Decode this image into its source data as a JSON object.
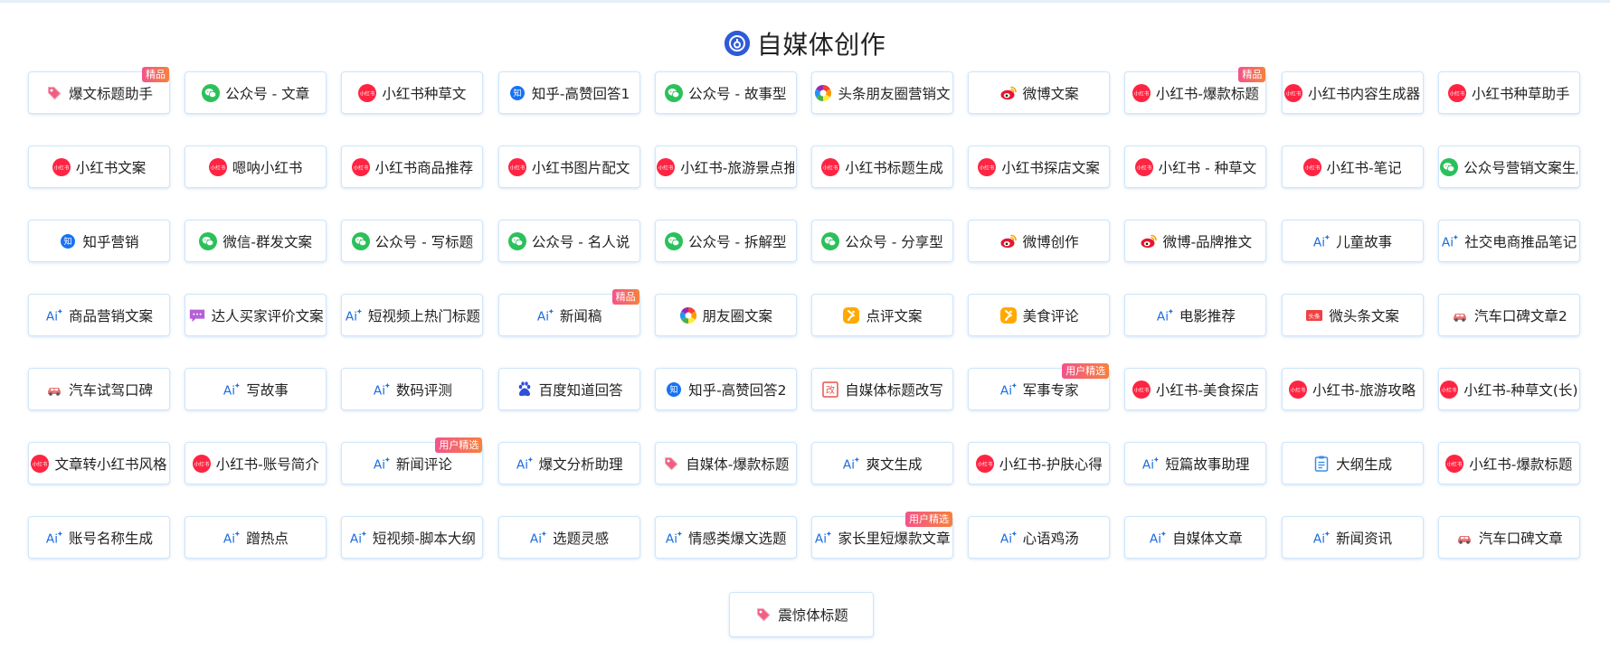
{
  "page": {
    "title": "自媒体创作"
  },
  "items": [
    {
      "label": "爆文标题助手",
      "icon": "tag-icon",
      "badge": "精品"
    },
    {
      "label": "公众号 - 文章",
      "icon": "wechat-icon"
    },
    {
      "label": "小红书种草文",
      "icon": "xiaohongshu-icon"
    },
    {
      "label": "知乎-高赞回答1",
      "icon": "zhihu-icon"
    },
    {
      "label": "公众号 - 故事型",
      "icon": "wechat-icon"
    },
    {
      "label": "头条朋友圈营销文",
      "icon": "aperture-icon"
    },
    {
      "label": "微博文案",
      "icon": "weibo-icon"
    },
    {
      "label": "小红书-爆款标题",
      "icon": "xiaohongshu-icon",
      "badge": "精品"
    },
    {
      "label": "小红书内容生成器",
      "icon": "xiaohongshu-icon"
    },
    {
      "label": "小红书种草助手",
      "icon": "xiaohongshu-icon"
    },
    {
      "label": "小红书文案",
      "icon": "xiaohongshu-icon"
    },
    {
      "label": "嗯呐小红书",
      "icon": "xiaohongshu-icon"
    },
    {
      "label": "小红书商品推荐",
      "icon": "xiaohongshu-icon"
    },
    {
      "label": "小红书图片配文",
      "icon": "xiaohongshu-icon"
    },
    {
      "label": "小红书-旅游景点推荐",
      "icon": "xiaohongshu-icon"
    },
    {
      "label": "小红书标题生成",
      "icon": "xiaohongshu-icon"
    },
    {
      "label": "小红书探店文案",
      "icon": "xiaohongshu-icon"
    },
    {
      "label": "小红书 - 种草文",
      "icon": "xiaohongshu-icon"
    },
    {
      "label": "小红书-笔记",
      "icon": "xiaohongshu-icon"
    },
    {
      "label": "公众号营销文案生成",
      "icon": "wechat-icon"
    },
    {
      "label": "知乎营销",
      "icon": "zhihu-icon"
    },
    {
      "label": "微信-群发文案",
      "icon": "wechat-icon"
    },
    {
      "label": "公众号 - 写标题",
      "icon": "wechat-icon"
    },
    {
      "label": "公众号 - 名人说",
      "icon": "wechat-icon"
    },
    {
      "label": "公众号 - 拆解型",
      "icon": "wechat-icon"
    },
    {
      "label": "公众号 - 分享型",
      "icon": "wechat-icon"
    },
    {
      "label": "微博创作",
      "icon": "weibo-icon"
    },
    {
      "label": "微博-品牌推文",
      "icon": "weibo-icon"
    },
    {
      "label": "儿童故事",
      "icon": "ai-icon"
    },
    {
      "label": "社交电商推品笔记",
      "icon": "ai-icon"
    },
    {
      "label": "商品营销文案",
      "icon": "ai-icon"
    },
    {
      "label": "达人买家评价文案",
      "icon": "chat-bubble-icon"
    },
    {
      "label": "短视频上热门标题",
      "icon": "ai-icon"
    },
    {
      "label": "新闻稿",
      "icon": "ai-icon",
      "badge": "精品"
    },
    {
      "label": "朋友圈文案",
      "icon": "aperture-icon"
    },
    {
      "label": "点评文案",
      "icon": "dianping-icon"
    },
    {
      "label": "美食评论",
      "icon": "dianping-icon"
    },
    {
      "label": "电影推荐",
      "icon": "ai-icon"
    },
    {
      "label": "微头条文案",
      "icon": "toutiao-icon"
    },
    {
      "label": "汽车口碑文章2",
      "icon": "car-icon"
    },
    {
      "label": "汽车试驾口碑",
      "icon": "car-icon"
    },
    {
      "label": "写故事",
      "icon": "ai-icon"
    },
    {
      "label": "数码评测",
      "icon": "ai-icon"
    },
    {
      "label": "百度知道回答",
      "icon": "baidu-icon"
    },
    {
      "label": "知乎-高赞回答2",
      "icon": "zhihu-icon"
    },
    {
      "label": "自媒体标题改写",
      "icon": "rewrite-icon"
    },
    {
      "label": "军事专家",
      "icon": "ai-icon",
      "badge": "用户精选"
    },
    {
      "label": "小红书-美食探店",
      "icon": "xiaohongshu-icon"
    },
    {
      "label": "小红书-旅游攻略",
      "icon": "xiaohongshu-icon"
    },
    {
      "label": "小红书-种草文(长)",
      "icon": "xiaohongshu-icon"
    },
    {
      "label": "文章转小红书风格",
      "icon": "xiaohongshu-icon"
    },
    {
      "label": "小红书-账号简介",
      "icon": "xiaohongshu-icon"
    },
    {
      "label": "新闻评论",
      "icon": "ai-icon",
      "badge": "用户精选"
    },
    {
      "label": "爆文分析助理",
      "icon": "ai-icon"
    },
    {
      "label": "自媒体-爆款标题",
      "icon": "tag-icon"
    },
    {
      "label": "爽文生成",
      "icon": "ai-icon"
    },
    {
      "label": "小红书-护肤心得",
      "icon": "xiaohongshu-icon"
    },
    {
      "label": "短篇故事助理",
      "icon": "ai-icon"
    },
    {
      "label": "大纲生成",
      "icon": "outline-icon"
    },
    {
      "label": "小红书-爆款标题",
      "icon": "xiaohongshu-icon"
    },
    {
      "label": "账号名称生成",
      "icon": "ai-icon"
    },
    {
      "label": "蹭热点",
      "icon": "ai-icon"
    },
    {
      "label": "短视频-脚本大纲",
      "icon": "ai-icon"
    },
    {
      "label": "选题灵感",
      "icon": "ai-icon"
    },
    {
      "label": "情感类爆文选题",
      "icon": "ai-icon"
    },
    {
      "label": "家长里短爆款文章",
      "icon": "ai-icon",
      "badge": "用户精选"
    },
    {
      "label": "心语鸡汤",
      "icon": "ai-icon"
    },
    {
      "label": "自媒体文章",
      "icon": "ai-icon"
    },
    {
      "label": "新闻资讯",
      "icon": "ai-icon"
    },
    {
      "label": "汽车口碑文章",
      "icon": "car-icon"
    }
  ],
  "bottom_item": {
    "label": "震惊体标题",
    "icon": "tag-icon"
  },
  "icon_text": {
    "xiaohongshu": "小红书",
    "zhihu": "知",
    "ai": "Ai",
    "toutiao": "头条",
    "rewrite": "改"
  },
  "colors": {
    "xiaohongshu": "#ff2442",
    "wechat": "#2bc15a",
    "zhihu": "#1772f6",
    "weibo": "#e6162d",
    "ai": "#1f6fe0",
    "dianping": "#ffaa00",
    "toutiao": "#f04142",
    "badge_start": "#f3548a",
    "badge_end": "#f7813c",
    "title_logo": "#2f5bd7"
  }
}
